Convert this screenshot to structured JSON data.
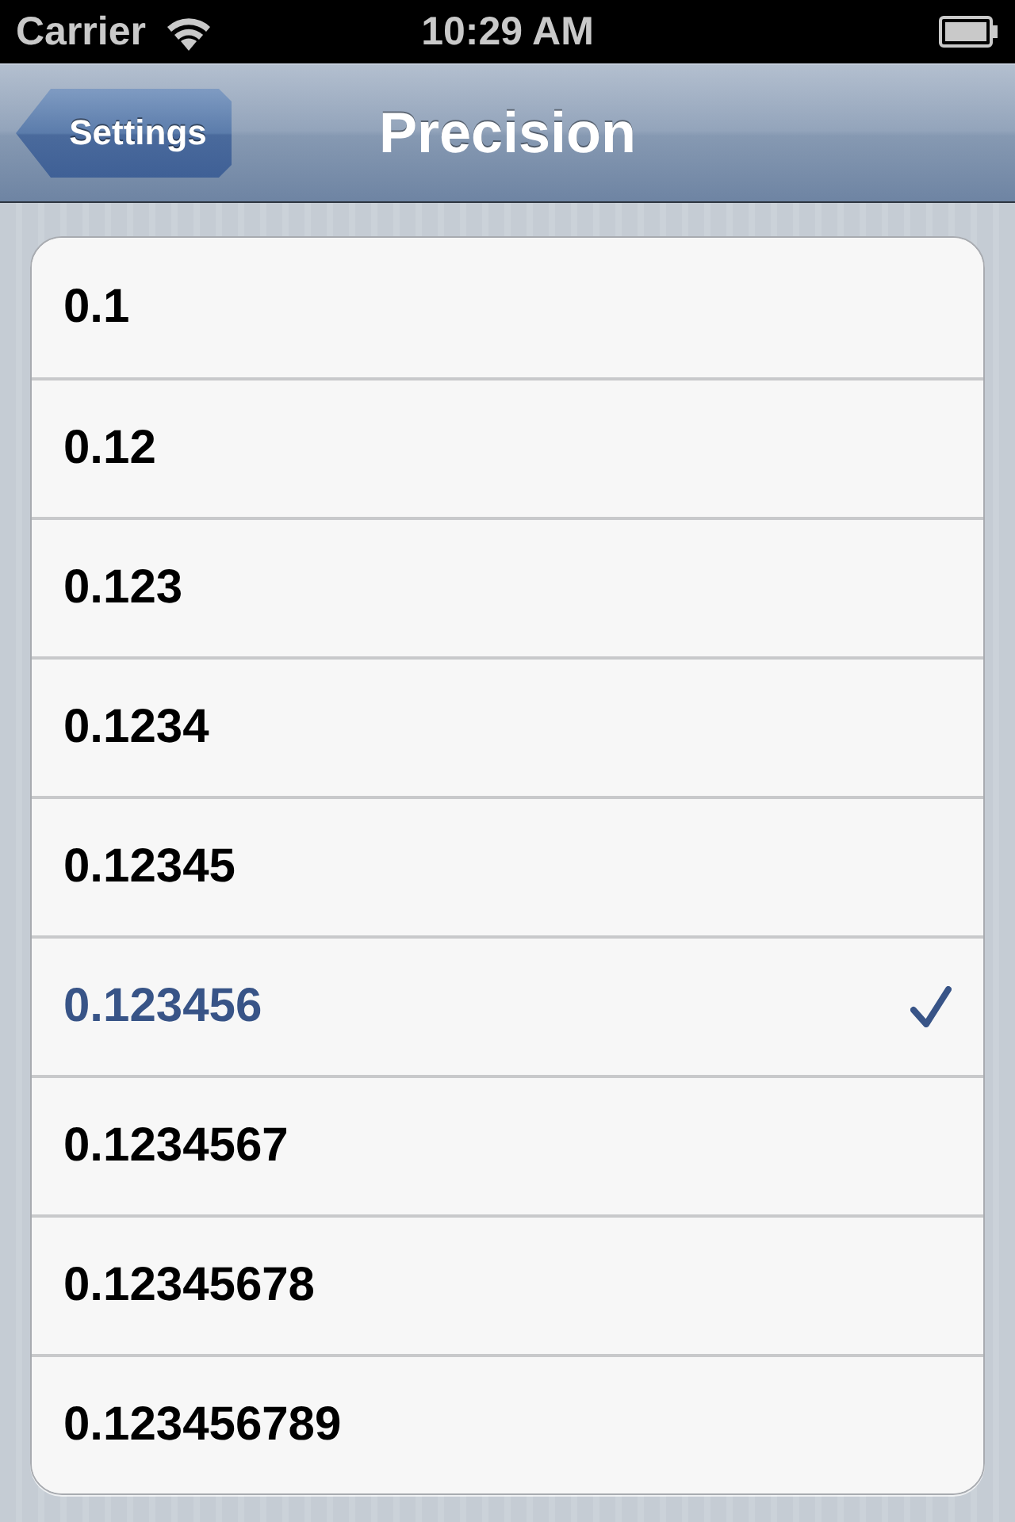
{
  "status_bar": {
    "carrier": "Carrier",
    "time": "10:29 AM"
  },
  "nav_bar": {
    "back_button": "Settings",
    "title": "Precision"
  },
  "options": [
    {
      "label": "0.1",
      "selected": false
    },
    {
      "label": "0.12",
      "selected": false
    },
    {
      "label": "0.123",
      "selected": false
    },
    {
      "label": "0.1234",
      "selected": false
    },
    {
      "label": "0.12345",
      "selected": false
    },
    {
      "label": "0.123456",
      "selected": true
    },
    {
      "label": "0.1234567",
      "selected": false
    },
    {
      "label": "0.12345678",
      "selected": false
    },
    {
      "label": "0.123456789",
      "selected": false
    }
  ]
}
